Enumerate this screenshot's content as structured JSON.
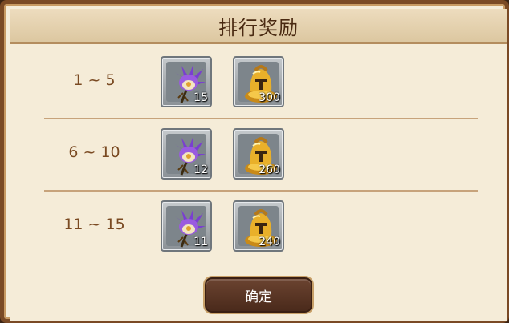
{
  "header": {
    "title": "排行奖励"
  },
  "tiers": [
    {
      "rank": "1 ~ 5",
      "rewards": [
        {
          "icon": "purple-flower-icon",
          "count": "15"
        },
        {
          "icon": "golden-helmet-icon",
          "count": "300"
        }
      ]
    },
    {
      "rank": "6 ~ 10",
      "rewards": [
        {
          "icon": "purple-flower-icon",
          "count": "12"
        },
        {
          "icon": "golden-helmet-icon",
          "count": "260"
        }
      ]
    },
    {
      "rank": "11 ~ 15",
      "rewards": [
        {
          "icon": "purple-flower-icon",
          "count": "11"
        },
        {
          "icon": "golden-helmet-icon",
          "count": "240"
        }
      ]
    }
  ],
  "confirm_button": {
    "label": "确定"
  }
}
